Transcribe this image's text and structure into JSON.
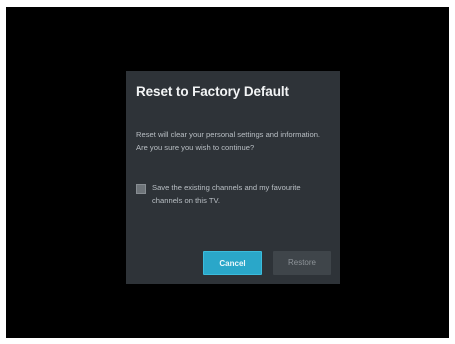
{
  "dialog": {
    "title": "Reset to Factory Default",
    "message_line1": "Reset will clear your personal settings and information.",
    "message_line2": "Are you sure you wish to continue?",
    "checkbox": {
      "label_line1": "Save the existing channels and my favourite",
      "label_line2": "channels on this TV.",
      "checked": false
    },
    "buttons": {
      "cancel_label": "Cancel",
      "restore_label": "Restore"
    }
  },
  "colors": {
    "screen_background": "#000000",
    "dialog_background": "#2e3338",
    "focused_button": "#2aa7c9",
    "unfocused_button": "#3f454a"
  }
}
